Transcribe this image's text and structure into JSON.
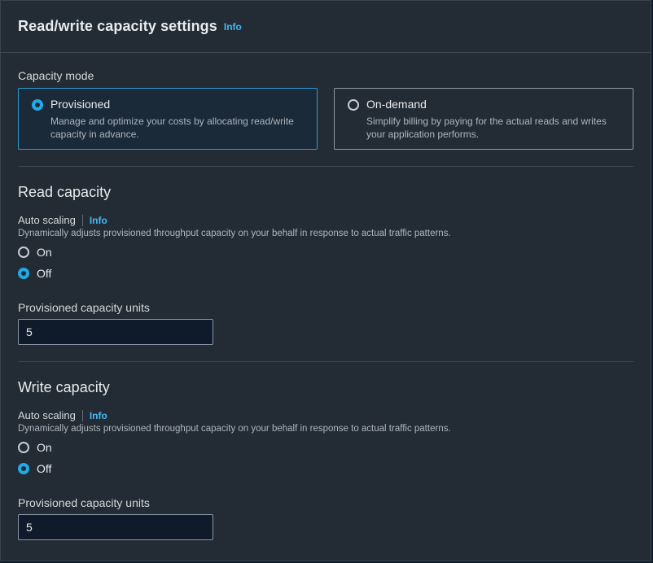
{
  "header": {
    "title": "Read/write capacity settings",
    "info": "Info"
  },
  "capacity_mode": {
    "label": "Capacity mode",
    "options": [
      {
        "title": "Provisioned",
        "description": "Manage and optimize your costs by allocating read/write capacity in advance.",
        "selected": true
      },
      {
        "title": "On-demand",
        "description": "Simplify billing by paying for the actual reads and writes your application performs.",
        "selected": false
      }
    ]
  },
  "read_capacity": {
    "heading": "Read capacity",
    "auto_scaling_label": "Auto scaling",
    "info": "Info",
    "description": "Dynamically adjusts provisioned throughput capacity on your behalf in response to actual traffic patterns.",
    "options": [
      {
        "label": "On",
        "selected": false
      },
      {
        "label": "Off",
        "selected": true
      }
    ],
    "units_label": "Provisioned capacity units",
    "units_value": "5"
  },
  "write_capacity": {
    "heading": "Write capacity",
    "auto_scaling_label": "Auto scaling",
    "info": "Info",
    "description": "Dynamically adjusts provisioned throughput capacity on your behalf in response to actual traffic patterns.",
    "options": [
      {
        "label": "On",
        "selected": false
      },
      {
        "label": "Off",
        "selected": true
      }
    ],
    "units_label": "Provisioned capacity units",
    "units_value": "5"
  },
  "colors": {
    "panel_bg": "#232b34",
    "accent": "#1faae8",
    "info_link": "#42b8f6",
    "selected_border": "#2a9bd6"
  }
}
